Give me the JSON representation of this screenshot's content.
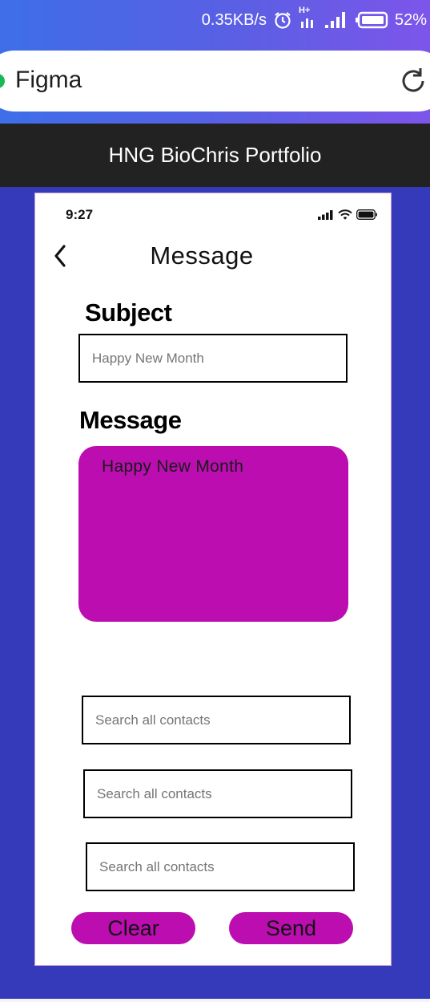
{
  "status_bar": {
    "speed": "0.35KB/s",
    "network": "H+",
    "battery": "52%"
  },
  "browser": {
    "url_title": "Figma"
  },
  "header": {
    "title": "HNG BioChris Portfolio"
  },
  "phone": {
    "time": "9:27",
    "nav_title": "Message",
    "subject_label": "Subject",
    "subject_placeholder": "Happy New Month",
    "message_label": "Message",
    "message_text": "Happy New Month",
    "contacts": [
      {
        "placeholder": "Search all contacts"
      },
      {
        "placeholder": "Search all contacts"
      },
      {
        "placeholder": "Search all contacts"
      }
    ],
    "clear_label": "Clear",
    "send_label": "Send"
  },
  "colors": {
    "accent": "#bb0db0",
    "background": "#343aba",
    "header": "#222222"
  },
  "icons": [
    "alarm-icon",
    "network-type-icon",
    "signal-icon",
    "battery-icon",
    "reload-icon",
    "back-chevron-icon",
    "wifi-icon"
  ]
}
